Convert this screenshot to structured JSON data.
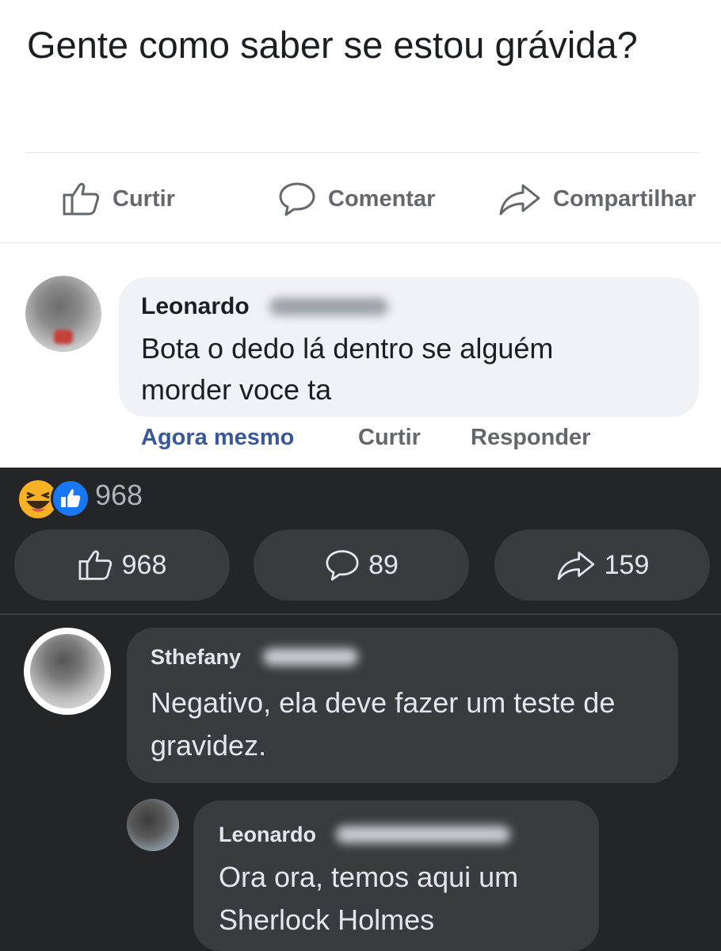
{
  "post": {
    "text": "Gente como saber se estou grávida?",
    "actions": {
      "like": "Curtir",
      "comment": "Comentar",
      "share": "Compartilhar"
    }
  },
  "comment1": {
    "author": "Leonardo",
    "text": "Bota o dedo lá dentro se alguém morder voce ta",
    "time": "Agora mesmo",
    "like": "Curtir",
    "reply": "Responder"
  },
  "reactions": {
    "count": "968",
    "icons": [
      "haha-icon",
      "like-icon"
    ]
  },
  "stats": {
    "likes": "968",
    "comments": "89",
    "shares": "159"
  },
  "comment2": {
    "author": "Sthefany",
    "text": "Negativo, ela deve fazer um teste de gravidez."
  },
  "comment3": {
    "author": "Leonardo",
    "text": "Ora ora, temos aqui um Sherlock Holmes"
  },
  "colors": {
    "link_blue": "#385898",
    "gray": "#65676b",
    "dark_bg": "#242526",
    "dark_bubble": "#3a3b3c",
    "like_blue": "#1877f2",
    "haha_yellow": "#f7b125"
  }
}
